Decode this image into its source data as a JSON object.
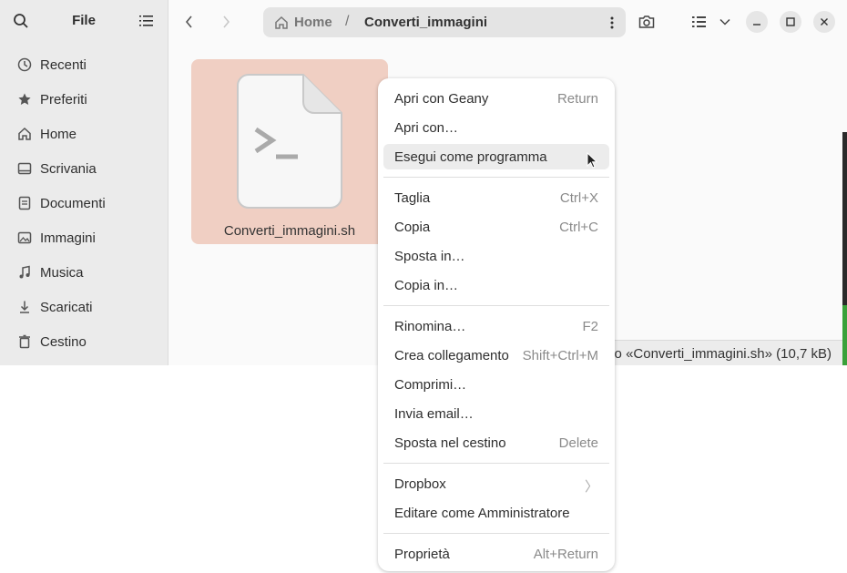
{
  "sidebar": {
    "title": "File",
    "search_icon": "search-icon",
    "menu_icon": "hamburger-menu-icon",
    "items": [
      {
        "label": "Recenti",
        "icon": "clock-icon"
      },
      {
        "label": "Preferiti",
        "icon": "star-icon"
      },
      {
        "label": "Home",
        "icon": "home-icon"
      },
      {
        "label": "Scrivania",
        "icon": "desktop-icon"
      },
      {
        "label": "Documenti",
        "icon": "document-icon"
      },
      {
        "label": "Immagini",
        "icon": "image-icon"
      },
      {
        "label": "Musica",
        "icon": "music-icon"
      },
      {
        "label": "Scaricati",
        "icon": "download-icon"
      },
      {
        "label": "Cestino",
        "icon": "trash-icon"
      }
    ]
  },
  "header": {
    "breadcrumb": {
      "home": "Home",
      "separator": "/",
      "current": "Converti_immagini"
    },
    "buttons": [
      "back-icon",
      "forward-icon",
      "path-menu-icon",
      "search-folder-icon",
      "list-view-icon",
      "view-options-chevron-icon",
      "minimize-icon",
      "maximize-icon",
      "close-icon"
    ]
  },
  "files": [
    {
      "name": "Converti_immagini.sh",
      "icon": "script-file-icon",
      "selected": true
    }
  ],
  "status_bar": {
    "text": "to «Converti_immagini.sh» (10,7 kB)"
  },
  "context_menu": {
    "groups": [
      [
        {
          "label": "Apri con Geany",
          "accel": "Return"
        },
        {
          "label": "Apri con…",
          "accel": ""
        },
        {
          "label": "Esegui come programma",
          "accel": "",
          "hover": true
        }
      ],
      [
        {
          "label": "Taglia",
          "accel": "Ctrl+X"
        },
        {
          "label": "Copia",
          "accel": "Ctrl+C"
        },
        {
          "label": "Sposta in…",
          "accel": ""
        },
        {
          "label": "Copia in…",
          "accel": ""
        }
      ],
      [
        {
          "label": "Rinomina…",
          "accel": "F2"
        },
        {
          "label": "Crea collegamento",
          "accel": "Shift+Ctrl+M"
        },
        {
          "label": "Comprimi…",
          "accel": ""
        },
        {
          "label": "Invia email…",
          "accel": ""
        },
        {
          "label": "Sposta nel cestino",
          "accel": "Delete"
        }
      ],
      [
        {
          "label": "Dropbox",
          "accel": "〉",
          "submenu": true
        },
        {
          "label": "Editare come Amministratore",
          "accel": ""
        }
      ],
      [
        {
          "label": "Proprietà",
          "accel": "Alt+Return"
        }
      ]
    ]
  },
  "colors": {
    "selection": "#f0cfc3",
    "sidebar_bg": "#ebebeb",
    "pathbar_bg": "#e4e4e4"
  }
}
